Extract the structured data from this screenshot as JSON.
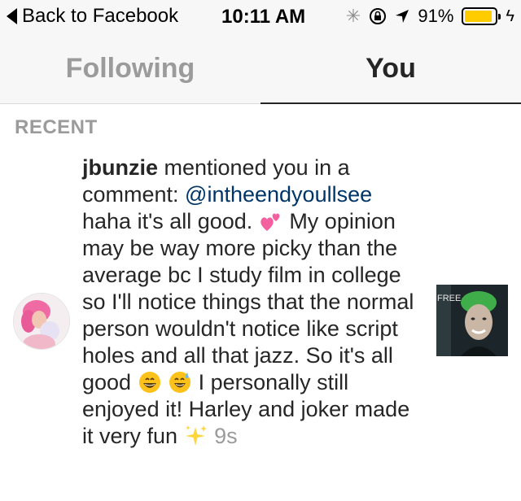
{
  "status_bar": {
    "back_label": "Back to Facebook",
    "time": "10:11 AM",
    "battery_pct": "91%",
    "battery_level": 0.91,
    "icons": [
      "activity-spinner-icon",
      "rotation-lock-icon",
      "location-arrow-icon",
      "battery-icon",
      "charging-bolt-icon"
    ],
    "battery_color": "#ffcc00"
  },
  "tabs": {
    "following": "Following",
    "you": "You",
    "active": "you"
  },
  "section": {
    "title": "RECENT"
  },
  "notification": {
    "username": "jbunzie",
    "text1": " mentioned you in a comment: ",
    "mention": "@intheendyoullsee",
    "text2": " haha it's all good. ",
    "text3": " My opinion may be way more picky than the average bc I study film in college so I'll notice things that the normal person wouldn't notice like script holes and all that jazz.  So it's all good ",
    "text4": " I personally still enjoyed it! Harley and joker made it very fun ",
    "time": "9s",
    "emojis": [
      "two-hearts-emoji",
      "grinning-emoji",
      "sweat-smile-emoji",
      "sparkles-emoji"
    ],
    "mention_color": "#003569"
  },
  "media": {
    "thumbnail_text": "FREE"
  }
}
